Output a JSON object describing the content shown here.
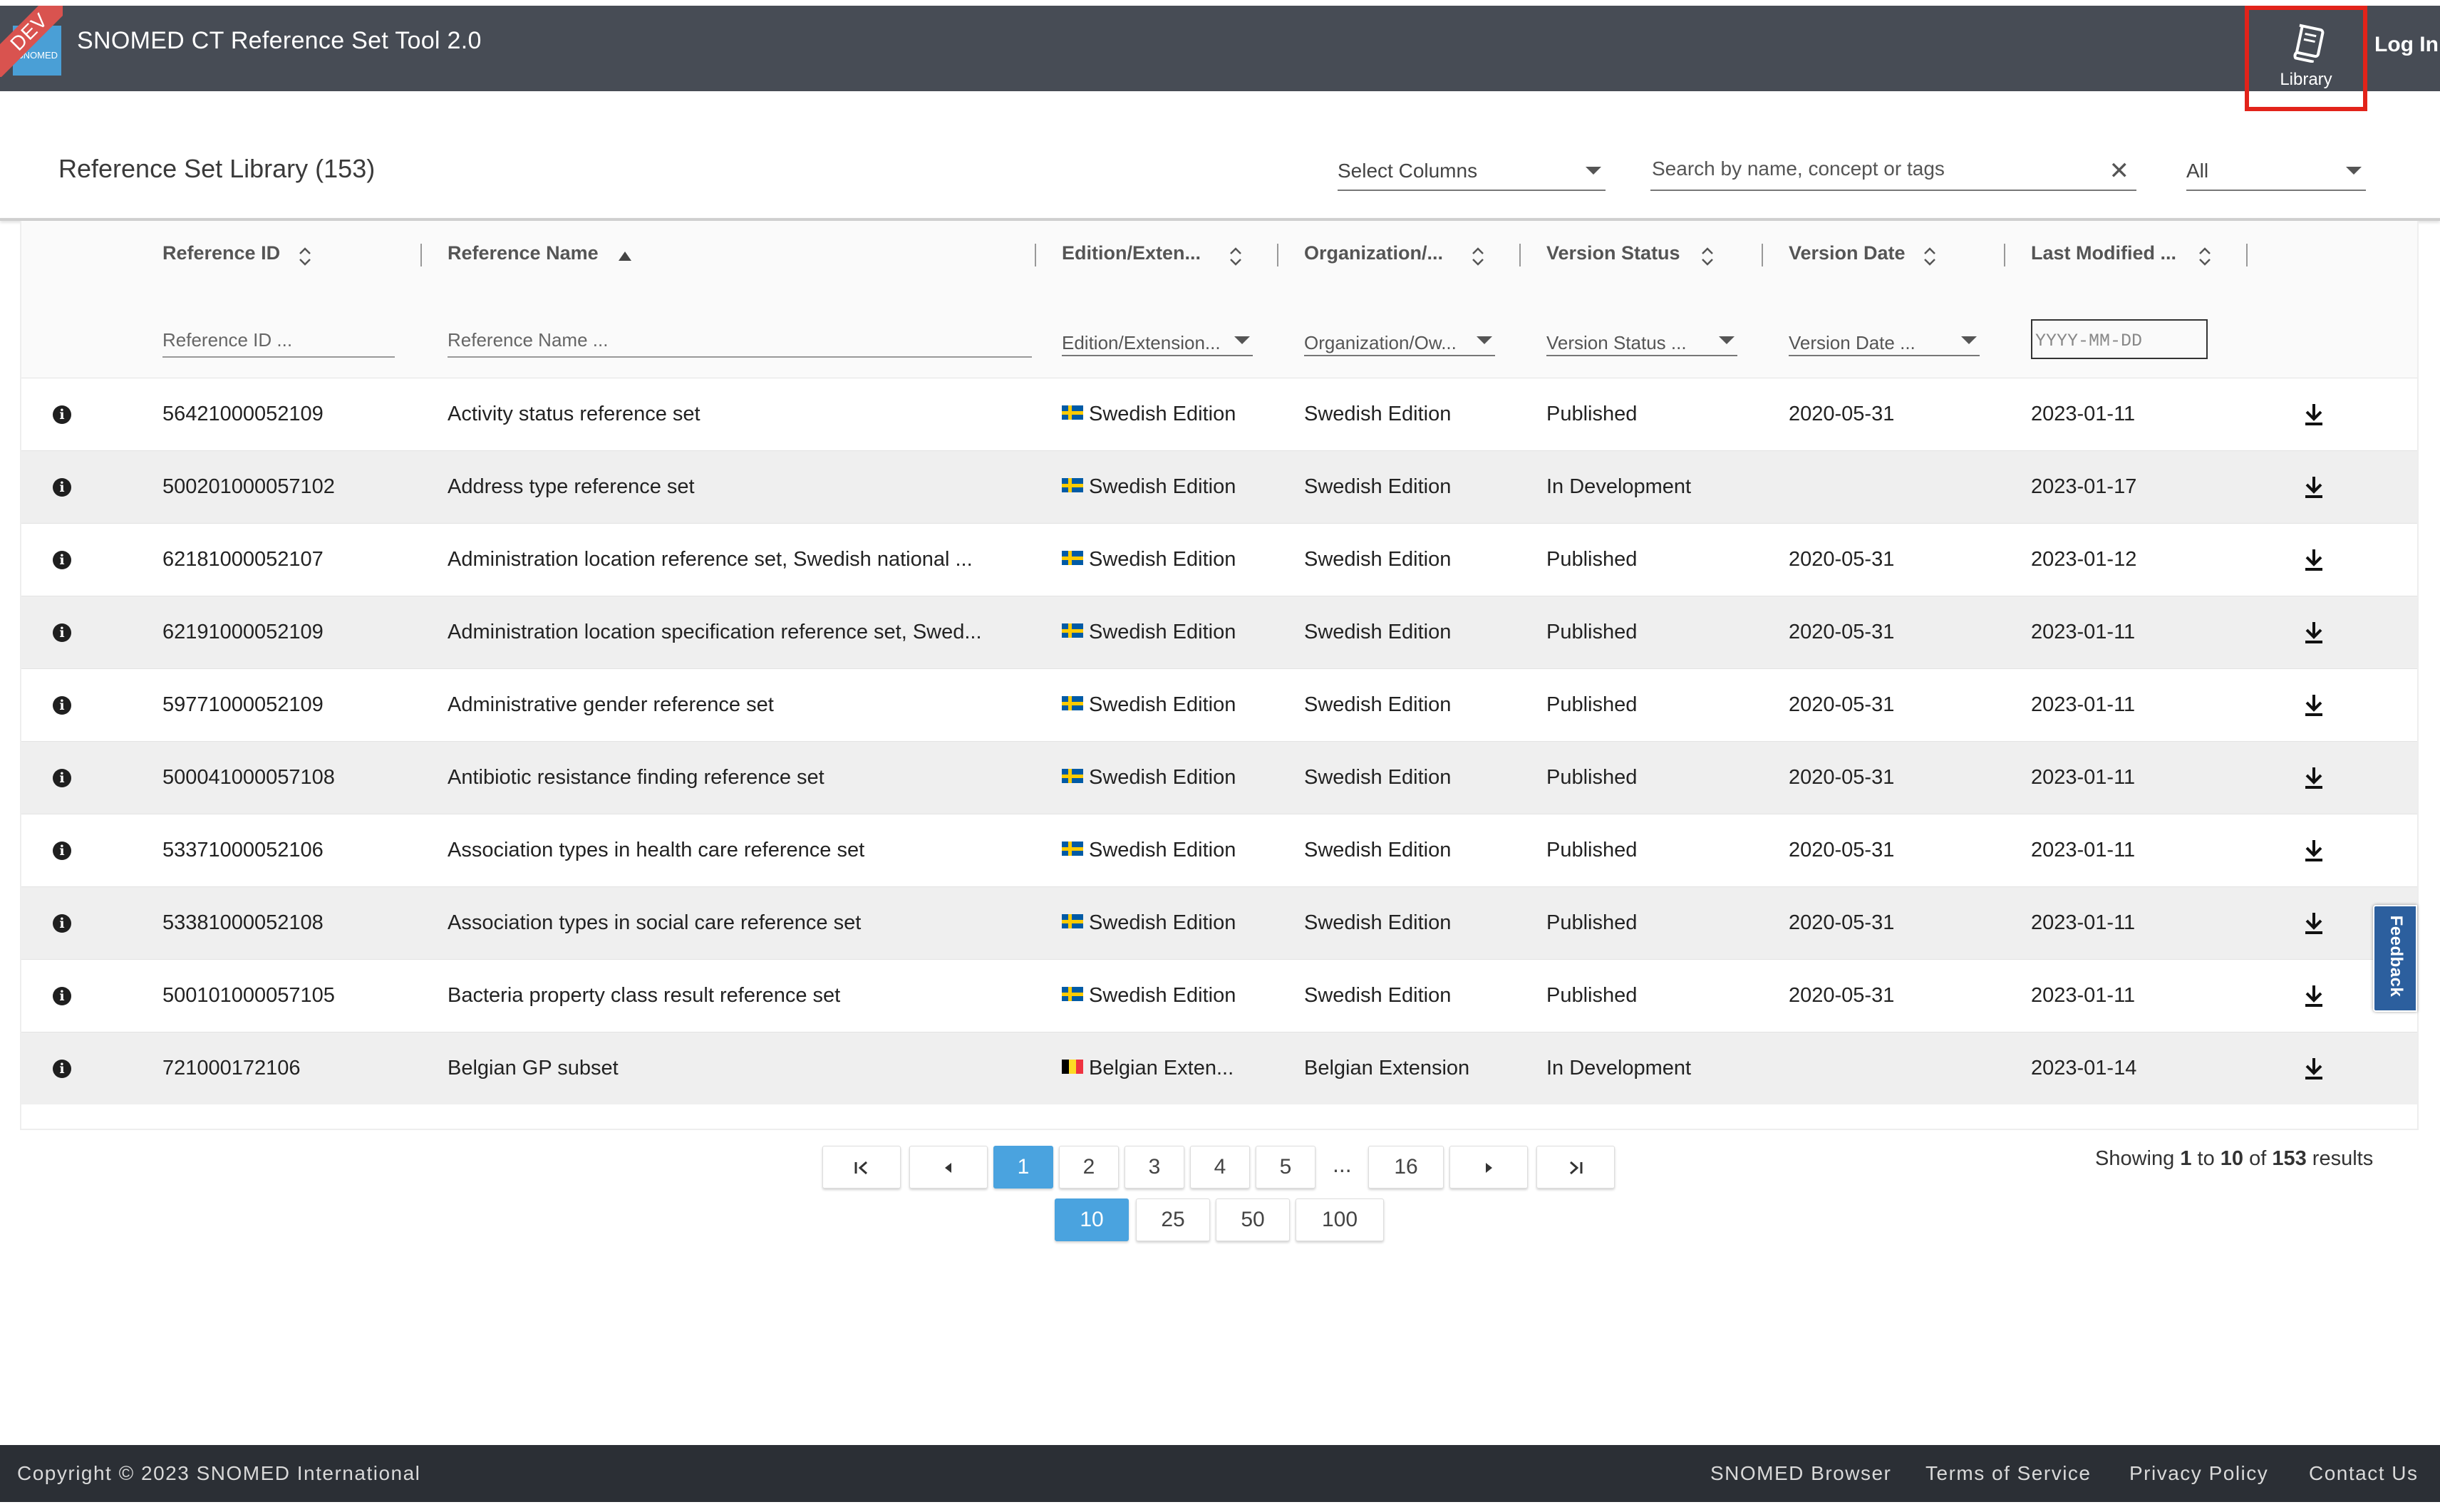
{
  "app": {
    "badge": "DEV",
    "logo_text": "SNOMED",
    "title": "SNOMED CT Reference Set Tool 2.0",
    "library_label": "Library",
    "login_label": "Log In"
  },
  "toolbar": {
    "page_title": "Reference Set Library (153)",
    "select_columns": "Select Columns",
    "search_placeholder": "Search by name, concept or tags",
    "filter_value": "All"
  },
  "table": {
    "columns": [
      "Reference ID",
      "Reference Name",
      "Edition/Exten...",
      "Organization/...",
      "Version Status",
      "Version Date",
      "Last Modified ..."
    ],
    "filters": {
      "reference_id": "Reference ID ...",
      "reference_name": "Reference Name ...",
      "edition": "Edition/Extension...",
      "organization": "Organization/Ow...",
      "version_status": "Version Status ...",
      "version_date": "Version Date ...",
      "last_modified": "YYYY-MM-DD"
    },
    "rows": [
      {
        "id": "56421000052109",
        "name": "Activity status reference set",
        "edition": "Swedish Edition",
        "flag": "se",
        "org": "Swedish Edition",
        "status": "Published",
        "version_date": "2020-05-31",
        "modified": "2023-01-11"
      },
      {
        "id": "500201000057102",
        "name": "Address type reference set",
        "edition": "Swedish Edition",
        "flag": "se",
        "org": "Swedish Edition",
        "status": "In Development",
        "version_date": "",
        "modified": "2023-01-17"
      },
      {
        "id": "62181000052107",
        "name": "Administration location reference set, Swedish national ...",
        "edition": "Swedish Edition",
        "flag": "se",
        "org": "Swedish Edition",
        "status": "Published",
        "version_date": "2020-05-31",
        "modified": "2023-01-12"
      },
      {
        "id": "62191000052109",
        "name": "Administration location specification reference set, Swed...",
        "edition": "Swedish Edition",
        "flag": "se",
        "org": "Swedish Edition",
        "status": "Published",
        "version_date": "2020-05-31",
        "modified": "2023-01-11"
      },
      {
        "id": "59771000052109",
        "name": "Administrative gender reference set",
        "edition": "Swedish Edition",
        "flag": "se",
        "org": "Swedish Edition",
        "status": "Published",
        "version_date": "2020-05-31",
        "modified": "2023-01-11"
      },
      {
        "id": "500041000057108",
        "name": "Antibiotic resistance finding reference set",
        "edition": "Swedish Edition",
        "flag": "se",
        "org": "Swedish Edition",
        "status": "Published",
        "version_date": "2020-05-31",
        "modified": "2023-01-11"
      },
      {
        "id": "53371000052106",
        "name": "Association types in health care reference set",
        "edition": "Swedish Edition",
        "flag": "se",
        "org": "Swedish Edition",
        "status": "Published",
        "version_date": "2020-05-31",
        "modified": "2023-01-11"
      },
      {
        "id": "53381000052108",
        "name": "Association types in social care reference set",
        "edition": "Swedish Edition",
        "flag": "se",
        "org": "Swedish Edition",
        "status": "Published",
        "version_date": "2020-05-31",
        "modified": "2023-01-11"
      },
      {
        "id": "500101000057105",
        "name": "Bacteria property class result reference set",
        "edition": "Swedish Edition",
        "flag": "se",
        "org": "Swedish Edition",
        "status": "Published",
        "version_date": "2020-05-31",
        "modified": "2023-01-11"
      },
      {
        "id": "721000172106",
        "name": "Belgian GP subset",
        "edition": "Belgian Exten...",
        "flag": "be",
        "org": "Belgian Extension",
        "status": "In Development",
        "version_date": "",
        "modified": "2023-01-14"
      }
    ]
  },
  "pagination": {
    "pages": [
      "1",
      "2",
      "3",
      "4",
      "5",
      "...",
      "16"
    ],
    "active_page": "1",
    "page_sizes": [
      "10",
      "25",
      "50",
      "100"
    ],
    "active_size": "10",
    "showing": {
      "prefix": "Showing",
      "from": "1",
      "to_word": "to",
      "to": "10",
      "of_word": "of",
      "total": "153",
      "suffix": "results"
    }
  },
  "feedback_label": "Feedback",
  "footer": {
    "copyright": "Copyright © 2023 SNOMED International",
    "links": [
      "SNOMED Browser",
      "Terms of Service",
      "Privacy Policy",
      "Contact Us"
    ]
  },
  "colors": {
    "topbar": "#474c55",
    "accent": "#4aa3df",
    "highlight": "#e2231a",
    "footer": "#2b2f35"
  }
}
